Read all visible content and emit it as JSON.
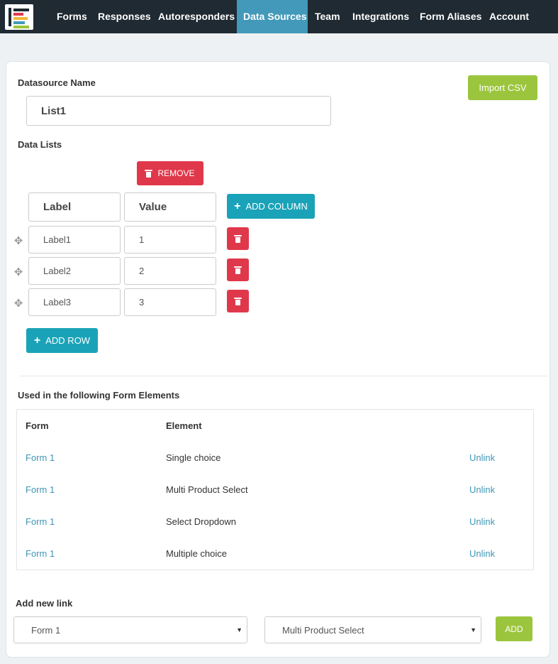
{
  "nav": {
    "items": [
      {
        "label": "Forms",
        "active": false
      },
      {
        "label": "Responses",
        "active": false
      },
      {
        "label": "Autoresponders",
        "active": false
      },
      {
        "label": "Data Sources",
        "active": true
      },
      {
        "label": "Team",
        "active": false
      },
      {
        "label": "Integrations",
        "active": false
      },
      {
        "label": "Form Aliases",
        "active": false
      },
      {
        "label": "Account",
        "active": false
      }
    ]
  },
  "datasource": {
    "name_label": "Datasource Name",
    "name_value": "List1",
    "import_label": "Import CSV"
  },
  "data_lists": {
    "title": "Data Lists",
    "remove_label": "REMOVE",
    "add_column_label": "ADD COLUMN",
    "add_row_label": "ADD ROW",
    "headers": [
      "Label",
      "Value"
    ],
    "rows": [
      {
        "label": "Label1",
        "value": "1"
      },
      {
        "label": "Label2",
        "value": "2"
      },
      {
        "label": "Label3",
        "value": "3"
      }
    ]
  },
  "usage": {
    "title": "Used in the following Form Elements",
    "col_form": "Form",
    "col_element": "Element",
    "rows": [
      {
        "form": "Form 1",
        "element": "Single choice",
        "action": "Unlink"
      },
      {
        "form": "Form 1",
        "element": "Multi Product Select",
        "action": "Unlink"
      },
      {
        "form": "Form 1",
        "element": "Select Dropdown",
        "action": "Unlink"
      },
      {
        "form": "Form 1",
        "element": "Multiple choice",
        "action": "Unlink"
      }
    ]
  },
  "add_link": {
    "title": "Add new link",
    "form_selected": "Form 1",
    "element_selected": "Multi Product Select",
    "add_label": "ADD"
  },
  "colors": {
    "nav_bg": "#1f2a32",
    "nav_active": "#4399b9",
    "green": "#9bc53d",
    "red": "#e0384b",
    "teal": "#1aa3b8",
    "link": "#3f97b6"
  },
  "icons": {
    "remove": "trash-icon",
    "add": "plus-icon",
    "drag": "move-icon",
    "dropdown": "caret-down-icon"
  }
}
